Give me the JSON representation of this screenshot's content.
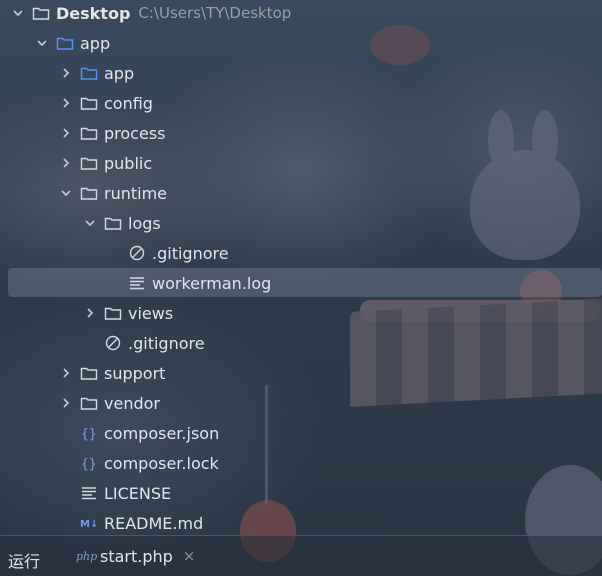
{
  "colors": {
    "folder": "#d6d9de",
    "module_folder": "#5b8cf2",
    "json_icon": "#7d9ce6",
    "md_icon": "#6f9af5",
    "selection": "#5a6478"
  },
  "tree": {
    "root": {
      "label": "Desktop",
      "path": "C:\\Users\\TY\\Desktop"
    },
    "items": [
      {
        "label": "app",
        "icon": "module-folder-icon"
      },
      {
        "label": "app",
        "icon": "module-folder-icon"
      },
      {
        "label": "config",
        "icon": "folder-icon"
      },
      {
        "label": "process",
        "icon": "folder-icon"
      },
      {
        "label": "public",
        "icon": "folder-icon"
      },
      {
        "label": "runtime",
        "icon": "folder-icon"
      },
      {
        "label": "logs",
        "icon": "folder-icon"
      },
      {
        "label": ".gitignore",
        "icon": "ignored-file-icon"
      },
      {
        "label": "workerman.log",
        "icon": "text-file-icon"
      },
      {
        "label": "views",
        "icon": "folder-icon"
      },
      {
        "label": ".gitignore",
        "icon": "ignored-file-icon"
      },
      {
        "label": "support",
        "icon": "folder-icon"
      },
      {
        "label": "vendor",
        "icon": "folder-icon"
      },
      {
        "label": "composer.json",
        "icon": "json-file-icon"
      },
      {
        "label": "composer.lock",
        "icon": "json-file-icon"
      },
      {
        "label": "LICENSE",
        "icon": "text-file-icon"
      },
      {
        "label": "README.md",
        "icon": "markdown-file-icon"
      }
    ]
  },
  "run_panel": {
    "title": "运行",
    "tab_label": "start.php",
    "tab_badge": "php",
    "close_glyph": "×"
  }
}
